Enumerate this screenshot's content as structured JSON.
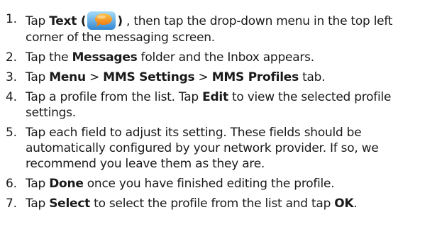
{
  "steps": [
    {
      "num": "1.",
      "pre1": "Tap ",
      "bold1": "Text (",
      "icon": "messaging-app-icon",
      "bold2": ")",
      "post": " , then tap the drop-down menu in the top left corner of the messaging screen."
    },
    {
      "num": "2.",
      "pre": "Tap the ",
      "bold": "Messages",
      "post": " folder and the Inbox appears."
    },
    {
      "num": "3.",
      "pre": "Tap ",
      "bold1": "Menu",
      "sep1": " > ",
      "bold2": "MMS Settings",
      "sep2": " > ",
      "bold3": "MMS Profiles",
      "post": " tab."
    },
    {
      "num": "4.",
      "pre": "Tap a profile from the list. Tap ",
      "bold": "Edit",
      "post": " to view the selected profile settings."
    },
    {
      "num": "5.",
      "text": "Tap each field to adjust its setting. These fields should be automatically configured by your network provider. If so, we recommend you leave them as they are."
    },
    {
      "num": "6.",
      "pre": "Tap ",
      "bold": "Done",
      "post": " once you have finished editing the profile."
    },
    {
      "num": "7.",
      "pre": "Tap ",
      "bold1": "Select",
      "mid": " to select the profile from the list and tap ",
      "bold2": "OK",
      "post": "."
    }
  ],
  "colors": {
    "icon_tile_top": "#9fd6f5",
    "icon_tile_bottom": "#2d86d4",
    "icon_bubble": "#f59a1b"
  }
}
